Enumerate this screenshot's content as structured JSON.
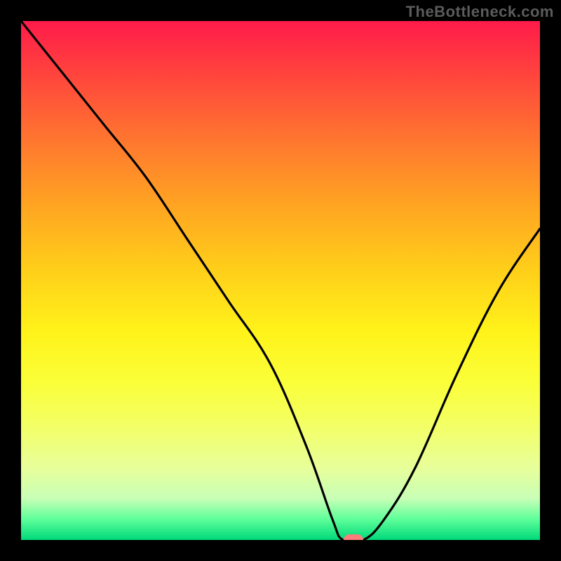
{
  "watermark": "TheBottleneck.com",
  "chart_data": {
    "type": "line",
    "title": "",
    "xlabel": "",
    "ylabel": "",
    "xlim": [
      0,
      100
    ],
    "ylim": [
      0,
      100
    ],
    "grid": false,
    "legend": false,
    "background": {
      "type": "vertical-gradient",
      "stops": [
        {
          "pos": 0,
          "color": "#ff1b4a"
        },
        {
          "pos": 12,
          "color": "#ff4b3b"
        },
        {
          "pos": 24,
          "color": "#ff7a2e"
        },
        {
          "pos": 36,
          "color": "#ffa621"
        },
        {
          "pos": 48,
          "color": "#ffcf1a"
        },
        {
          "pos": 60,
          "color": "#fff31a"
        },
        {
          "pos": 70,
          "color": "#faff3a"
        },
        {
          "pos": 78,
          "color": "#f3ff66"
        },
        {
          "pos": 86,
          "color": "#e8ff9a"
        },
        {
          "pos": 92,
          "color": "#c8ffb6"
        },
        {
          "pos": 96,
          "color": "#5eff9a"
        },
        {
          "pos": 100,
          "color": "#00d97a"
        }
      ]
    },
    "series": [
      {
        "name": "bottleneck-curve",
        "color": "#000000",
        "x": [
          0,
          8,
          16,
          24,
          32,
          40,
          48,
          55,
          60,
          62,
          66,
          70,
          76,
          84,
          92,
          100
        ],
        "y": [
          100,
          90,
          80,
          70,
          58,
          46,
          34,
          18,
          4,
          0,
          0,
          4,
          14,
          32,
          48,
          60
        ]
      }
    ],
    "marker": {
      "name": "optimal-point",
      "x": 64,
      "y": 0,
      "color": "#ff7d7d"
    }
  }
}
